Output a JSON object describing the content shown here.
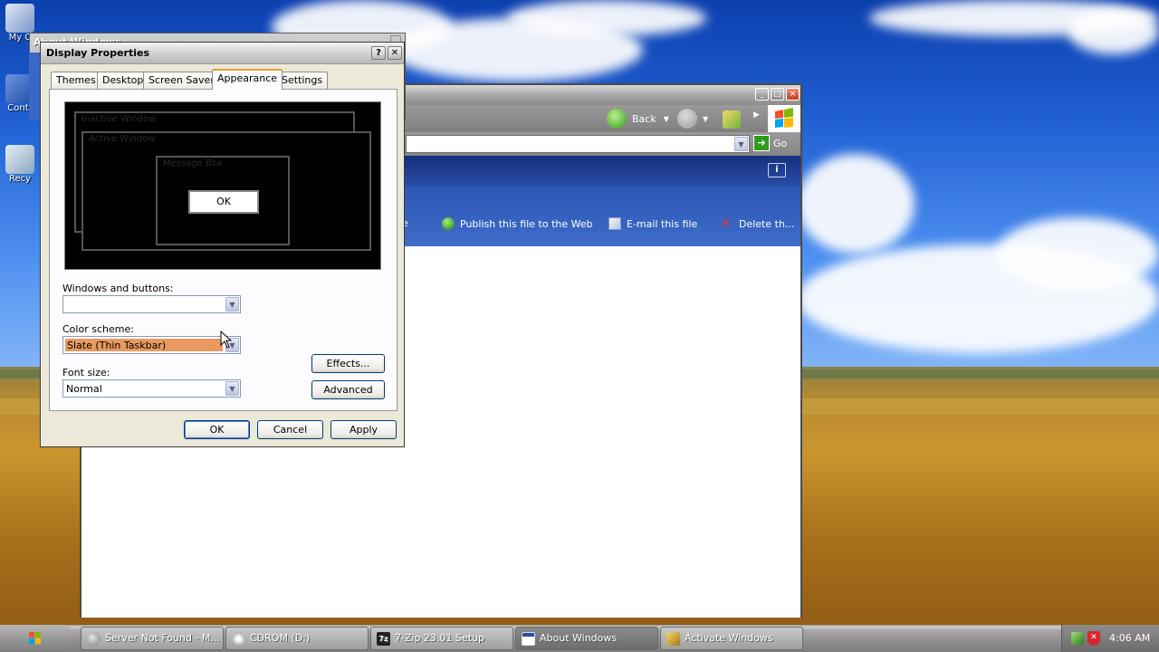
{
  "desktop": {
    "icons": [
      {
        "label": "My C"
      },
      {
        "label": "Contr"
      },
      {
        "label": "Recy"
      }
    ]
  },
  "about_window": {
    "title": "About Windows"
  },
  "explorer": {
    "toolbar": {
      "back_label": "Back"
    },
    "address": {
      "go_label": "Go"
    },
    "tasks": [
      {
        "label": "Publish this file to the Web"
      },
      {
        "label": "E-mail this file"
      },
      {
        "label": "Delete th..."
      }
    ],
    "partial_task_label": "e"
  },
  "dialog": {
    "title": "Display Properties",
    "help_label": "?",
    "close_label": "✕",
    "tabs": [
      {
        "label": "Themes"
      },
      {
        "label": "Desktop"
      },
      {
        "label": "Screen Saver"
      },
      {
        "label": "Appearance",
        "active": true
      },
      {
        "label": "Settings"
      }
    ],
    "preview": {
      "inactive_caption": "Inactive Window",
      "active_caption": "Active Window",
      "message_caption": "Message Box",
      "ok_label": "OK"
    },
    "windows_buttons": {
      "label": "Windows and buttons:",
      "value": ""
    },
    "color_scheme": {
      "label": "Color scheme:",
      "value": "Slate (Thin Taskbar)",
      "highlight": "#e89a61"
    },
    "font_size": {
      "label": "Font size:",
      "value": "Normal"
    },
    "effects_label": "Effects...",
    "advanced_label": "Advanced",
    "ok_label": "OK",
    "cancel_label": "Cancel",
    "apply_label": "Apply"
  },
  "taskbar": {
    "tasks": [
      {
        "label": "Server Not Found - M...",
        "icon": "browser-icon"
      },
      {
        "label": "CDROM (D:)",
        "icon": "cdrom-icon"
      },
      {
        "label": "7-Zip 23.01 Setup",
        "icon": "7zip-icon"
      },
      {
        "label": "About Windows",
        "icon": "window-icon",
        "active": true
      },
      {
        "label": "Activate Windows",
        "icon": "keys-icon"
      }
    ],
    "clock": "4:06 AM"
  }
}
